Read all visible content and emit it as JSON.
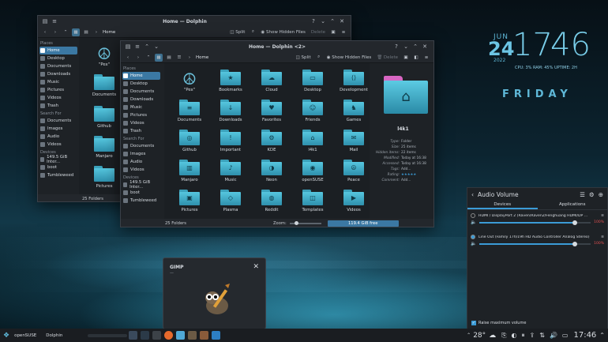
{
  "back_window": {
    "title": "Home — Dolphin",
    "breadcrumb": "Home",
    "split_label": "Split",
    "hidden_label": "Show Hidden Files",
    "delete_label": "Delete",
    "places_header": "Places",
    "places": [
      "Home",
      "Desktop",
      "Documents",
      "Downloads",
      "Music",
      "Pictures",
      "Videos",
      "Trash"
    ],
    "search_header": "Search For",
    "search": [
      "Documents",
      "Images",
      "Audio",
      "Videos"
    ],
    "devices_header": "Devices",
    "devices": [
      "149.5 GiB Inter...",
      "boot",
      "Tumbleweed"
    ],
    "files": [
      "\"Pex\"",
      "Documents",
      "Github",
      "Manjaro",
      "Pictures"
    ],
    "status": "25 Folders"
  },
  "front_window": {
    "title": "Home — Dolphin <2>",
    "breadcrumb": "Home",
    "split_label": "Split",
    "hidden_label": "Show Hidden Files",
    "delete_label": "Delete",
    "places_header": "Places",
    "places": [
      "Home",
      "Desktop",
      "Documents",
      "Downloads",
      "Music",
      "Pictures",
      "Videos",
      "Trash"
    ],
    "search_header": "Search For",
    "search": [
      "Documents",
      "Images",
      "Audio",
      "Videos"
    ],
    "devices_header": "Devices",
    "devices": [
      "149.5 GiB Inter...",
      "boot",
      "Tumbleweed"
    ],
    "files": [
      "\"Pex\"",
      "Bookmarks",
      "Cloud",
      "Desktop",
      "Development",
      "Documents",
      "Downloads",
      "Favorites",
      "Friends",
      "Games",
      "Github",
      "Important",
      "KDE",
      "l4k1",
      "Mail",
      "Manjaro",
      "Music",
      "Neon",
      "openSUSE",
      "Peace",
      "Pictures",
      "Plasma",
      "Reddit",
      "Templates",
      "Videos"
    ],
    "status": "25 Folders",
    "zoom_label": "Zoom:",
    "free_space": "119.4 GiB free",
    "preview": {
      "name": "l4k1",
      "rows": [
        {
          "k": "Type:",
          "v": "Folder"
        },
        {
          "k": "Size:",
          "v": "25 items"
        },
        {
          "k": "Hidden items:",
          "v": "22 items"
        },
        {
          "k": "Modified:",
          "v": "Today at 16:38"
        },
        {
          "k": "Accessed:",
          "v": "Today at 16:38"
        },
        {
          "k": "Tags:",
          "v": "Add..."
        },
        {
          "k": "Rating:",
          "v": "★★★★★"
        },
        {
          "k": "Comment:",
          "v": "Add..."
        }
      ]
    }
  },
  "clock": {
    "month": "JUN",
    "day": "24",
    "year": "2022",
    "time_h": "17",
    "time_m": "46",
    "stats": "CPU: 3%  RAM: 45%  UPTIME: 2H",
    "weekday": "FRIDAY"
  },
  "audio": {
    "title": "Audio Volume",
    "tabs": [
      "Devices",
      "Applications"
    ],
    "devices": [
      {
        "name": "HDMI / DisplayPort 2 (Raven/Raven2/Fenghuang HDMI/DP ...",
        "volume": 100,
        "pct": "100%"
      },
      {
        "name": "Line Out (Family 17h/19h HD Audio Controller Analog Stereo)",
        "volume": 100,
        "pct": "100%"
      }
    ],
    "raise_label": "Raise maximum volume"
  },
  "gimp": {
    "title": "GIMP",
    "subtitle": "—"
  },
  "taskbar": {
    "os_label": "openSUSE",
    "app_label": "Dolphin",
    "temp": "28°",
    "time": "17:46"
  },
  "colors": {
    "accent": "#3b78a3",
    "folder": "#4fbcd6",
    "clock": "#5fb8d8"
  }
}
